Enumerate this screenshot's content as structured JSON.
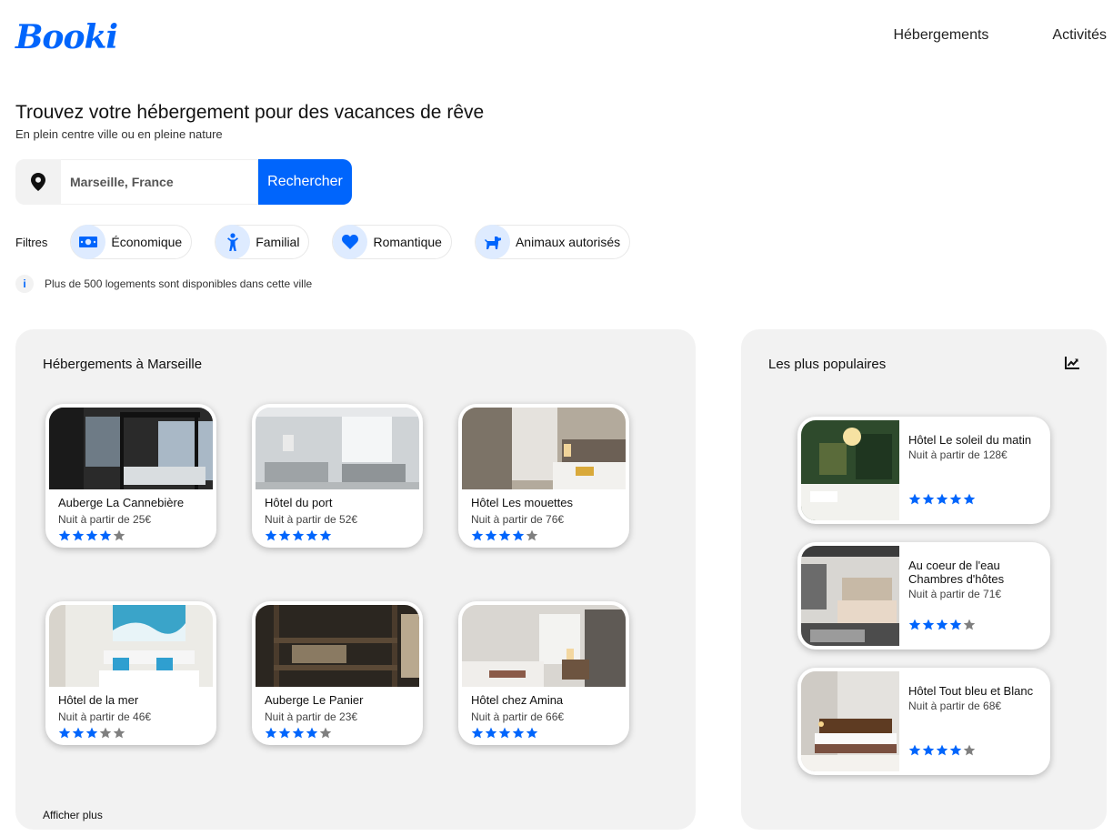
{
  "header": {
    "logo": "Booki",
    "nav": [
      "Hébergements",
      "Activités"
    ]
  },
  "hero": {
    "title": "Trouvez votre hébergement pour des vacances de rêve",
    "subtitle": "En plein centre ville ou en pleine nature"
  },
  "search": {
    "value": "Marseille, France",
    "button": "Rechercher",
    "icon": "location-pin-icon"
  },
  "filters": {
    "label": "Filtres",
    "items": [
      {
        "label": "Économique",
        "icon": "money-icon"
      },
      {
        "label": "Familial",
        "icon": "child-icon"
      },
      {
        "label": "Romantique",
        "icon": "heart-icon"
      },
      {
        "label": "Animaux autorisés",
        "icon": "dog-icon"
      }
    ]
  },
  "info": "Plus de 500 logements sont disponibles dans cette ville",
  "accommodations": {
    "title": "Hébergements à Marseille",
    "more": "Afficher plus",
    "items": [
      {
        "name": "Auberge La Cannebière",
        "price": "Nuit à partir de 25€",
        "rating": 4
      },
      {
        "name": "Hôtel du port",
        "price": "Nuit à partir de 52€",
        "rating": 5
      },
      {
        "name": "Hôtel Les mouettes",
        "price": "Nuit à partir de 76€",
        "rating": 4
      },
      {
        "name": "Hôtel de la mer",
        "price": "Nuit à partir de 46€",
        "rating": 3
      },
      {
        "name": "Auberge Le Panier",
        "price": "Nuit à partir de 23€",
        "rating": 4
      },
      {
        "name": "Hôtel chez Amina",
        "price": "Nuit à partir de 66€",
        "rating": 5
      }
    ]
  },
  "popular": {
    "title": "Les plus populaires",
    "icon": "trending-up-icon",
    "items": [
      {
        "name": "Hôtel Le soleil du matin",
        "price": "Nuit à partir de 128€",
        "rating": 5
      },
      {
        "name": "Au coeur de l'eau Chambres d'hôtes",
        "price": "Nuit à partir de 71€",
        "rating": 4
      },
      {
        "name": "Hôtel Tout bleu et Blanc",
        "price": "Nuit à partir de 68€",
        "rating": 4
      }
    ]
  },
  "colors": {
    "accent": "#0065fc",
    "accent_light": "#deebff",
    "star_off": "#7f7f7f",
    "panel_bg": "#f2f2f2"
  }
}
